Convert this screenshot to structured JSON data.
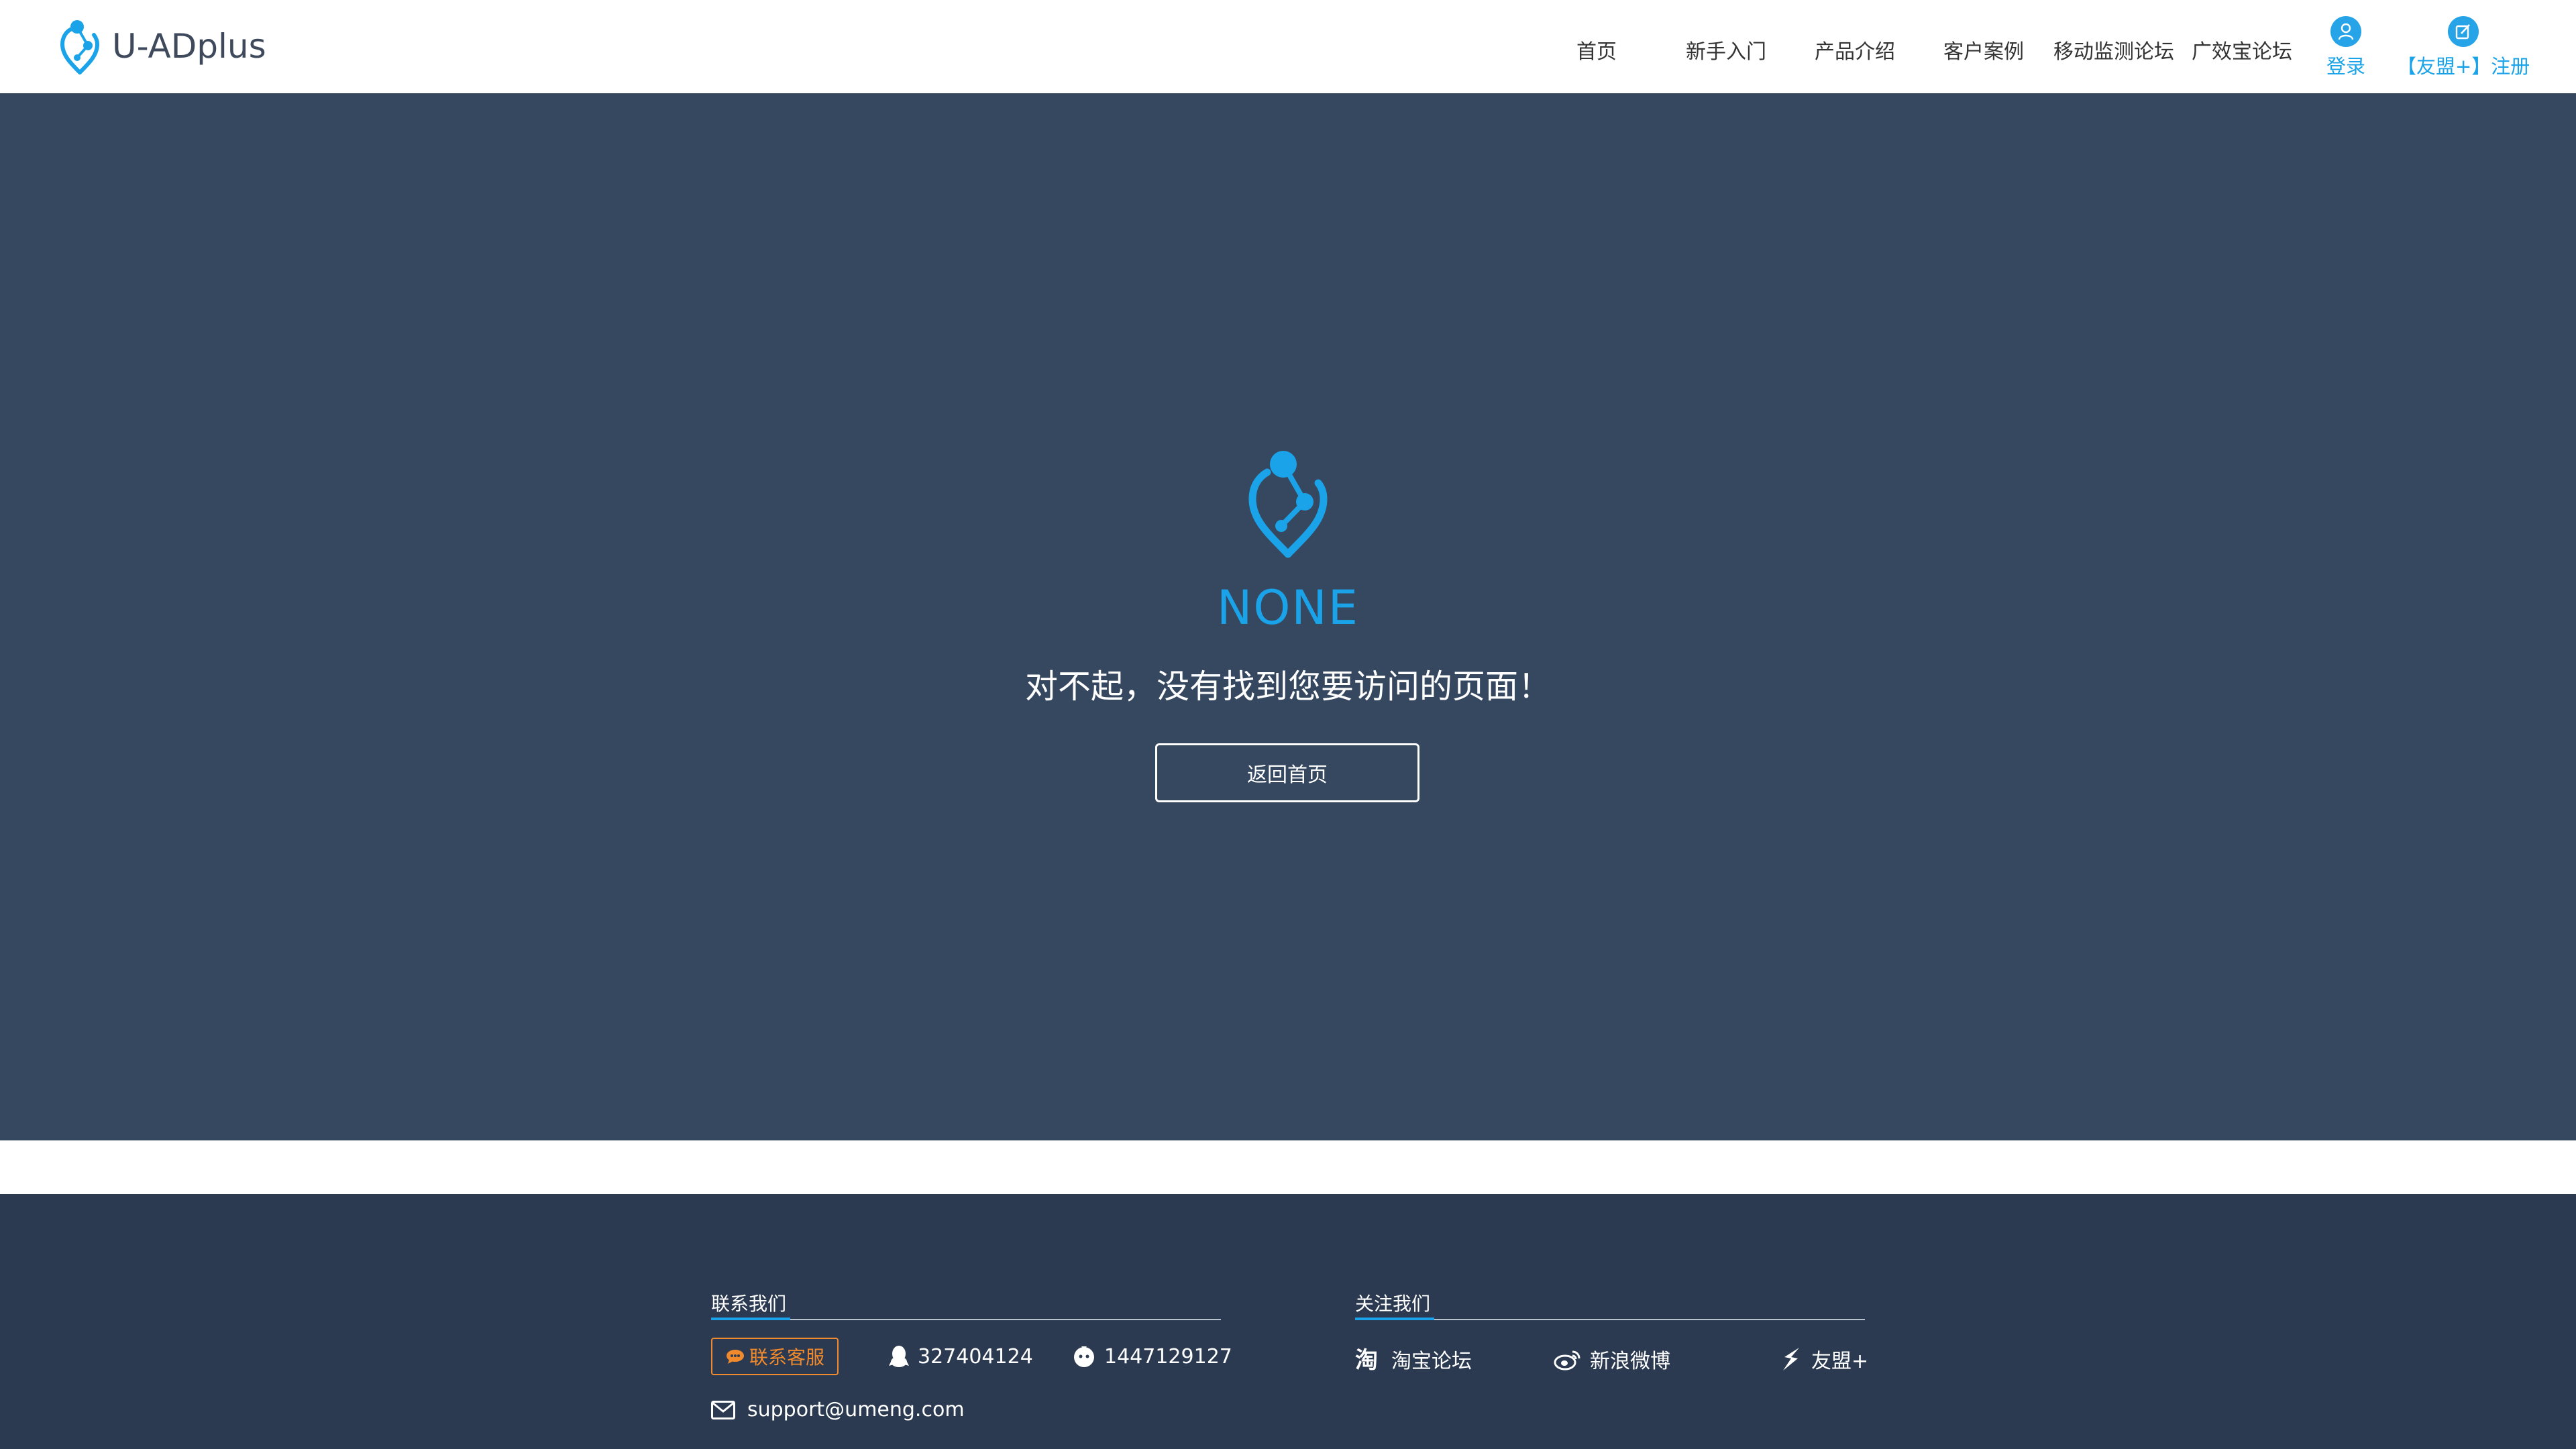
{
  "header": {
    "logo_text": "U-ADplus",
    "nav": [
      {
        "label": "首页"
      },
      {
        "label": "新手入门"
      },
      {
        "label": "产品介绍"
      },
      {
        "label": "客户案例"
      },
      {
        "label": "移动监测论坛"
      },
      {
        "label": "广效宝论坛"
      }
    ],
    "login_label": "登录",
    "register_label": "【友盟+】注册"
  },
  "error": {
    "code_text": "NONE",
    "message": "对不起，没有找到您要访问的页面！",
    "back_button": "返回首页"
  },
  "footer": {
    "contact_heading": "联系我们",
    "follow_heading": "关注我们",
    "customer_service": "联系客服",
    "qq_group_1": "327404124",
    "qq_group_2": "1447129127",
    "email": "support@umeng.com",
    "follow_links": [
      {
        "label": "淘宝论坛",
        "icon": "taobao-icon"
      },
      {
        "label": "新浪微博",
        "icon": "weibo-icon"
      },
      {
        "label": "友盟+",
        "icon": "umeng-icon"
      }
    ]
  },
  "colors": {
    "accent": "#1aa3e8",
    "main_bg": "#364760",
    "footer_bg": "#2b3a50",
    "service_orange": "#f08a2c"
  }
}
